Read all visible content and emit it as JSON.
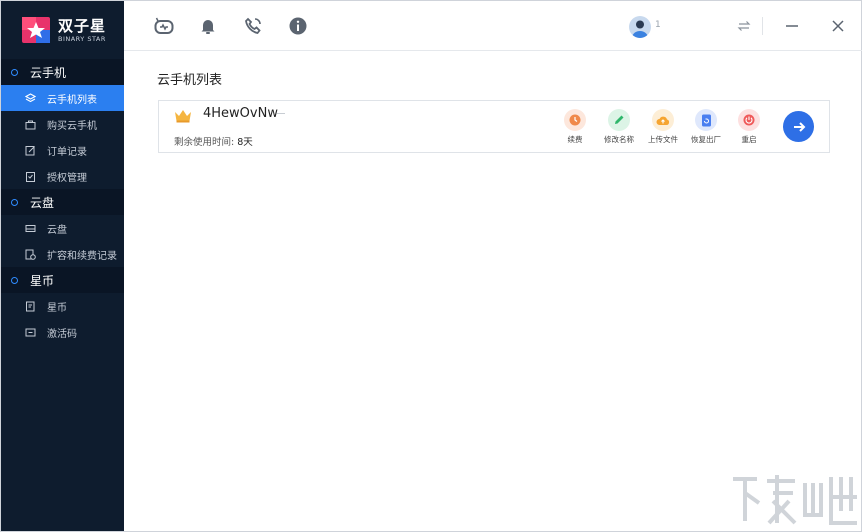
{
  "app": {
    "name_cn": "双子星",
    "name_en": "BINARY STAR"
  },
  "sidebar": {
    "sections": [
      {
        "label": "云手机",
        "items": [
          {
            "label": "云手机列表",
            "icon": "layers-icon",
            "active": true
          },
          {
            "label": "购买云手机",
            "icon": "bag-icon"
          },
          {
            "label": "订单记录",
            "icon": "edit-icon"
          },
          {
            "label": "授权管理",
            "icon": "clipboard-icon"
          }
        ]
      },
      {
        "label": "云盘",
        "items": [
          {
            "label": "云盘",
            "icon": "drive-icon"
          },
          {
            "label": "扩容和续费记录",
            "icon": "record-icon"
          }
        ]
      },
      {
        "label": "星币",
        "items": [
          {
            "label": "星币",
            "icon": "coin-doc-icon"
          },
          {
            "label": "激活码",
            "icon": "code-icon"
          }
        ]
      }
    ]
  },
  "topbar": {
    "icons": [
      "robot-icon",
      "bell-icon",
      "phone-call-icon",
      "info-icon"
    ],
    "user_badge": "1"
  },
  "main": {
    "title": "云手机列表",
    "device": {
      "name": "4HewOvNw",
      "remaining_label": "剩余使用时间:",
      "remaining_value": "8天",
      "actions": [
        {
          "label": "续费",
          "color": "#f0894a",
          "bg": "#fde7dc"
        },
        {
          "label": "修改名称",
          "color": "#2fb66b",
          "bg": "#dcf4e6"
        },
        {
          "label": "上传文件",
          "color": "#f6a531",
          "bg": "#fdeed6"
        },
        {
          "label": "恢复出厂",
          "color": "#4a7ff0",
          "bg": "#dfe8fc"
        },
        {
          "label": "重启",
          "color": "#ef5a5a",
          "bg": "#fde0e0"
        }
      ]
    }
  },
  "colors": {
    "sidebar_bg": "#0e1c2e",
    "section_bg": "#0a1525",
    "accent": "#2b7ff0"
  }
}
